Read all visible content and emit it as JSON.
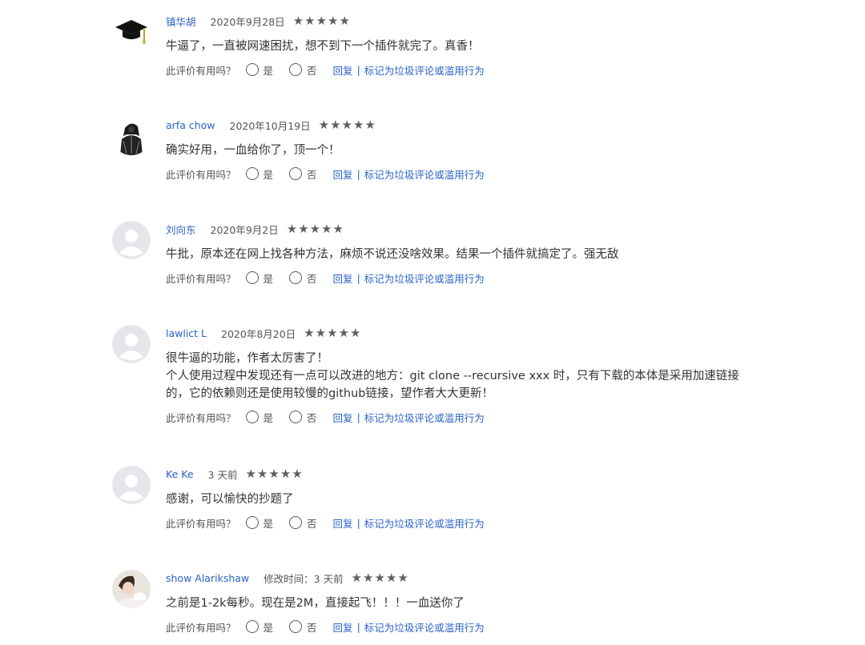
{
  "ui": {
    "helpful_question": "此评价有用吗？",
    "yes": "是",
    "no": "否",
    "reply": "回复",
    "separator": "|",
    "report": "标记为垃圾评论或滥用行为",
    "star_glyph": "★"
  },
  "reviews": [
    {
      "author": "镇华胡",
      "date": "2020年9月28日",
      "rating": 5,
      "avatar_icon": "graduation-cap-icon",
      "lines": [
        "牛逼了，一直被网速困扰，想不到下一个插件就完了。真香！"
      ]
    },
    {
      "author": "arfa chow",
      "date": "2020年10月19日",
      "rating": 5,
      "avatar_icon": "hooded-figure-icon",
      "lines": [
        "确实好用，一血给你了，顶一个！"
      ]
    },
    {
      "author": "刘向东",
      "date": "2020年9月2日",
      "rating": 5,
      "avatar_icon": "default-user-icon",
      "lines": [
        "牛批，原本还在网上找各种方法，麻烦不说还没啥效果。结果一个插件就搞定了。强无敌"
      ]
    },
    {
      "author": "lawlict L",
      "date": "2020年8月20日",
      "rating": 5,
      "avatar_icon": "default-user-icon",
      "lines": [
        "很牛逼的功能，作者太厉害了！",
        "个人使用过程中发现还有一点可以改进的地方：git clone --recursive xxx 时，只有下载的本体是采用加速链接",
        "的，它的依赖则还是使用较慢的github链接，望作者大大更新！"
      ]
    },
    {
      "author": "Ke Ke",
      "date": "3 天前",
      "rating": 5,
      "avatar_icon": "default-user-icon",
      "lines": [
        "感谢，可以愉快的抄题了"
      ]
    },
    {
      "author": "show Alarikshaw",
      "date": "修改时间：3 天前",
      "rating": 5,
      "avatar_icon": "photo-avatar-icon",
      "lines": [
        "之前是1-2k每秒。现在是2M，直接起飞！！！一血送你了"
      ]
    }
  ]
}
